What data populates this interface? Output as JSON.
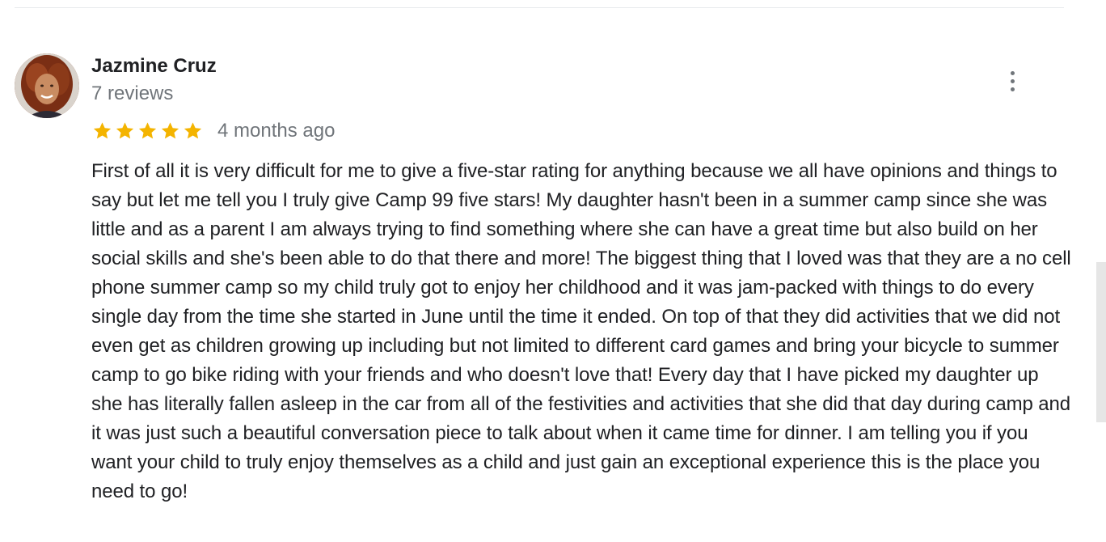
{
  "review": {
    "author_name": "Jazmine Cruz",
    "review_count": "7 reviews",
    "rating": 5,
    "rating_max": 5,
    "time_ago": "4 months ago",
    "text": "First of all it is very difficult for me to give a five-star rating for anything because we all have opinions and things to say but let me tell you I truly give Camp 99 five stars! My daughter hasn't been in a summer camp since she was little and as a parent I am always trying to find something where she can have a great time but also build on her social skills and she's been able to do that there and more! The biggest thing that I loved was that they are a no cell phone summer camp so my child truly got to enjoy her childhood and it was jam-packed with things to do every single day from the time she started in June until the time it ended. On top of that they did activities that we did not even get as children growing up including but not limited to different card games and bring your bicycle to summer camp to go bike riding with your friends and who doesn't love that! Every day that I have picked my daughter up she has literally fallen asleep in the car from all of the festivities and activities that she did that day during camp and it was just such a beautiful conversation piece to talk about when it came time for dinner. I am telling you if you want your child to truly enjoy themselves as a child and just gain an exceptional experience this is the place you need to go!"
  },
  "icons": {
    "star": "star-icon",
    "more": "more-vert-icon",
    "avatar": "avatar-photo"
  },
  "colors": {
    "star": "#f4b400",
    "secondary_text": "#70757a",
    "primary_text": "#202124"
  }
}
